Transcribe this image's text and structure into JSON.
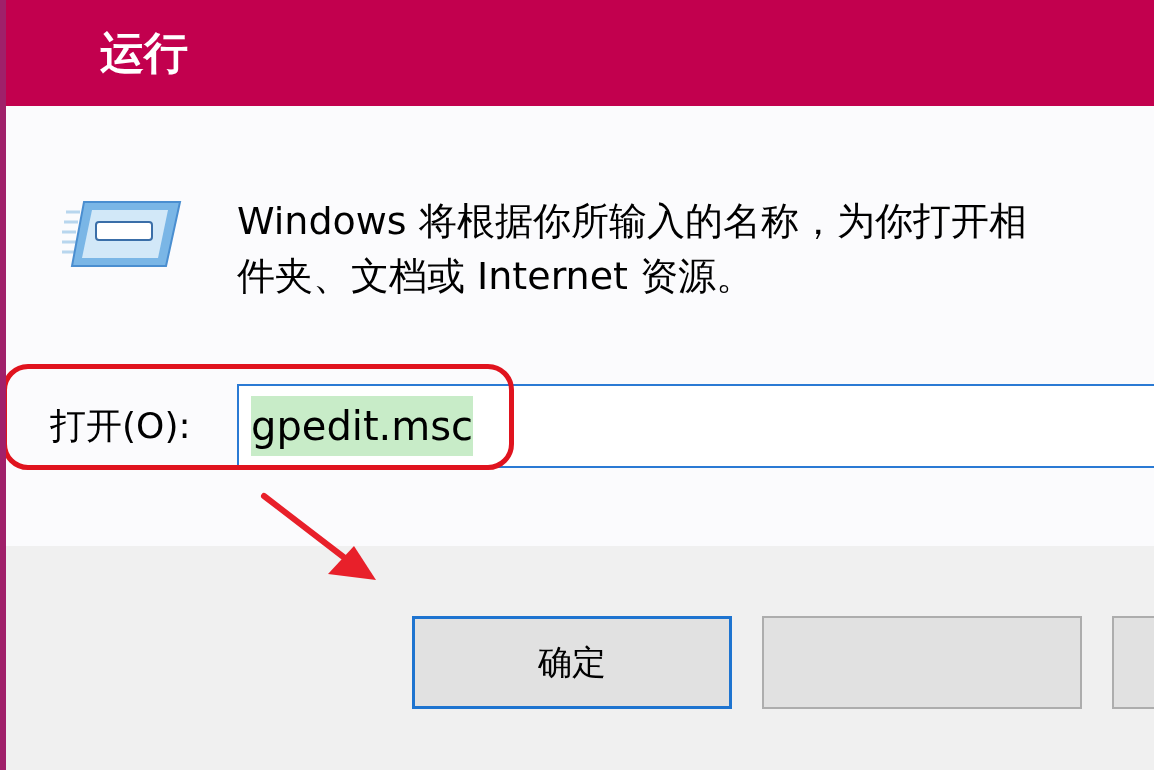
{
  "window": {
    "title": "运行"
  },
  "description": [
    "Windows 将根据你所输入的名称，为你打开相",
    "件夹、文档或 Internet 资源。"
  ],
  "open_field": {
    "label": "打开(O):",
    "value": "gpedit.msc",
    "value_selected": true
  },
  "buttons": [
    {
      "label": "确定",
      "default": true
    },
    {
      "default": false
    },
    {
      "default": false
    }
  ]
}
